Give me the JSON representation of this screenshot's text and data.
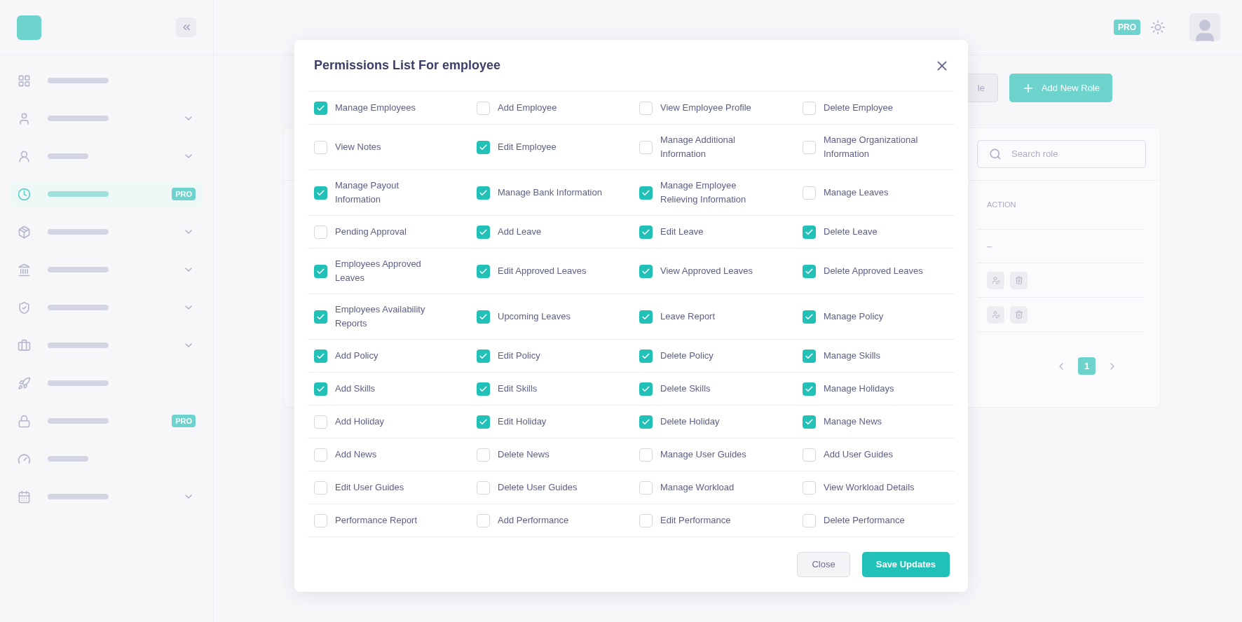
{
  "sidebar": {
    "items": [
      {
        "selected": false,
        "has_submenu": false
      },
      {
        "selected": false,
        "has_submenu": true
      },
      {
        "selected": false,
        "has_submenu": true
      },
      {
        "selected": true,
        "has_submenu": false,
        "badge": "PRO"
      },
      {
        "selected": false,
        "has_submenu": true
      },
      {
        "selected": false,
        "has_submenu": true
      },
      {
        "selected": false,
        "has_submenu": true
      },
      {
        "selected": false,
        "has_submenu": true
      },
      {
        "selected": false,
        "has_submenu": false
      },
      {
        "selected": false,
        "has_submenu": false,
        "badge": "PRO"
      },
      {
        "selected": false,
        "has_submenu": false
      },
      {
        "selected": false,
        "has_submenu": true
      }
    ]
  },
  "header": {
    "badge": "PRO"
  },
  "toolbar": {
    "buttons": [
      {
        "label": "le",
        "kind": "secondary"
      },
      {
        "label": "Add New Role",
        "kind": "primary"
      }
    ]
  },
  "roles_card": {
    "search": {
      "placeholder": "Search role"
    },
    "columns": [
      "ACTION"
    ],
    "rows": [
      {
        "kind": "text",
        "action": "–"
      },
      {
        "kind": "buttons"
      },
      {
        "kind": "buttons"
      }
    ],
    "pagination": [
      {
        "label": "1",
        "selected": true
      }
    ]
  },
  "modal": {
    "title": "Permissions List For employee",
    "rows": [
      [
        {
          "label": "Manage Employees",
          "checked": true
        },
        {
          "label": "Add Employee",
          "checked": false
        },
        {
          "label": "View Employee Profile",
          "checked": false
        },
        {
          "label": "Delete Employee",
          "checked": false
        }
      ],
      [
        {
          "label": "View Notes",
          "checked": false
        },
        {
          "label": "Edit Employee",
          "checked": true
        },
        {
          "label": "Manage Additional Information",
          "checked": false
        },
        {
          "label": "Manage Organizational Information",
          "checked": false
        }
      ],
      [
        {
          "label": "Manage Payout Information",
          "checked": true
        },
        {
          "label": "Manage Bank Information",
          "checked": true
        },
        {
          "label": "Manage Employee Relieving Information",
          "checked": true
        },
        {
          "label": "Manage Leaves",
          "checked": false
        }
      ],
      [
        {
          "label": "Pending Approval",
          "checked": false
        },
        {
          "label": "Add Leave",
          "checked": true
        },
        {
          "label": "Edit Leave",
          "checked": true
        },
        {
          "label": "Delete Leave",
          "checked": true
        }
      ],
      [
        {
          "label": "Employees Approved Leaves",
          "checked": true
        },
        {
          "label": "Edit Approved Leaves",
          "checked": true
        },
        {
          "label": "View Approved Leaves",
          "checked": true
        },
        {
          "label": "Delete Approved Leaves",
          "checked": true
        }
      ],
      [
        {
          "label": "Employees Availability Reports",
          "checked": true
        },
        {
          "label": "Upcoming Leaves",
          "checked": true
        },
        {
          "label": "Leave Report",
          "checked": true
        },
        {
          "label": "Manage Policy",
          "checked": true
        }
      ],
      [
        {
          "label": "Add Policy",
          "checked": true
        },
        {
          "label": "Edit Policy",
          "checked": true
        },
        {
          "label": "Delete Policy",
          "checked": true
        },
        {
          "label": "Manage Skills",
          "checked": true
        }
      ],
      [
        {
          "label": "Add Skills",
          "checked": true
        },
        {
          "label": "Edit Skills",
          "checked": true
        },
        {
          "label": "Delete Skills",
          "checked": true
        },
        {
          "label": "Manage Holidays",
          "checked": true
        }
      ],
      [
        {
          "label": "Add Holiday",
          "checked": false
        },
        {
          "label": "Edit Holiday",
          "checked": true
        },
        {
          "label": "Delete Holiday",
          "checked": true
        },
        {
          "label": "Manage News",
          "checked": true
        }
      ],
      [
        {
          "label": "Add News",
          "checked": false
        },
        {
          "label": "Delete News",
          "checked": false
        },
        {
          "label": "Manage User Guides",
          "checked": false
        },
        {
          "label": "Add User Guides",
          "checked": false
        }
      ],
      [
        {
          "label": "Edit User Guides",
          "checked": false
        },
        {
          "label": "Delete User Guides",
          "checked": false
        },
        {
          "label": "Manage Workload",
          "checked": false
        },
        {
          "label": "View Workload Details",
          "checked": false
        }
      ],
      [
        {
          "label": "Performance Report",
          "checked": false
        },
        {
          "label": "Add Performance",
          "checked": false
        },
        {
          "label": "Edit Performance",
          "checked": false
        },
        {
          "label": "Delete Performance",
          "checked": false
        }
      ]
    ],
    "buttons": [
      {
        "label": "Close",
        "kind": "secondary"
      },
      {
        "label": "Save Updates",
        "kind": "primary"
      }
    ]
  }
}
